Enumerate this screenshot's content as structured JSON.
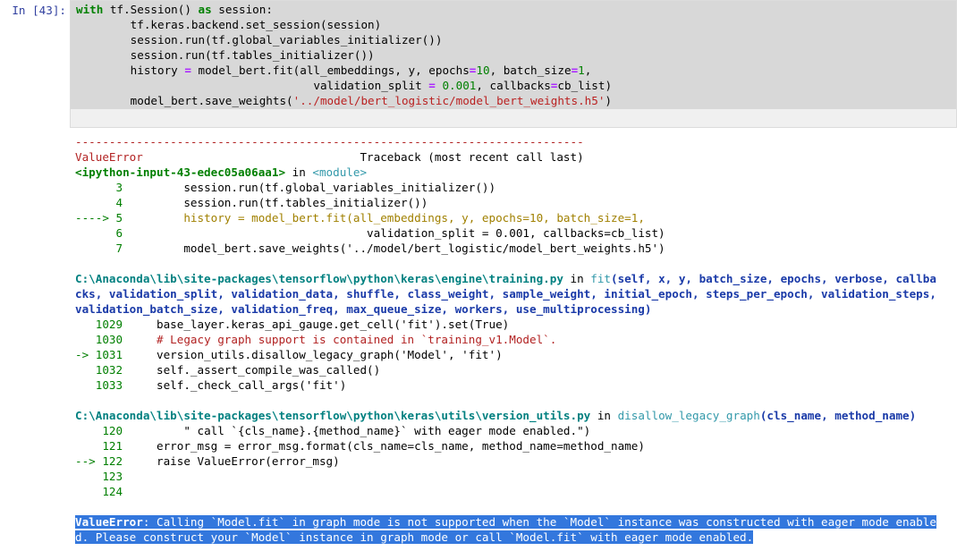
{
  "prompt": "In [43]:",
  "code": {
    "l1_kw": "with",
    "l1_rest": " tf.Session() ",
    "l1_as": "as",
    "l1_end": " session:",
    "l2": "        tf.keras.backend.set_session(session)",
    "l3": "        session.run(tf.global_variables_initializer())",
    "l4": "        session.run(tf.tables_initializer())",
    "l5_a": "        history ",
    "l5_eq": "=",
    "l5_b": " model_bert.fit(all_embeddings, y, epochs",
    "l5_eq2": "=",
    "l5_n1": "10",
    "l5_c": ", batch_size",
    "l5_eq3": "=",
    "l5_n2": "1",
    "l5_d": ",",
    "l6_a": "                                   validation_split ",
    "l6_eq": "=",
    "l6_sp": " ",
    "l6_n": "0.001",
    "l6_b": ", callbacks",
    "l6_eq2": "=",
    "l6_c": "cb_list)",
    "l7_a": "        model_bert.save_weights(",
    "l7_str": "'../model/bert_logistic/model_bert_weights.h5'",
    "l7_b": ")"
  },
  "traceback": {
    "dashes": "---------------------------------------------------------------------------",
    "err_name": "ValueError",
    "tb_header": "                                Traceback (most recent call last)",
    "input_ref": "<ipython-input-43-edec05a06aa1>",
    "in_word": " in ",
    "module": "<module>",
    "f1": [
      {
        "num": "      3",
        "code": "         session.run(tf.global_variables_initializer())"
      },
      {
        "num": "      4",
        "code": "         session.run(tf.tables_initializer())"
      }
    ],
    "f1_arrow": "----> 5",
    "f1_hl": "         history = model_bert.fit(all_embeddings, y, epochs=10, batch_size=1,",
    "f1_after": [
      {
        "num": "      6",
        "code": "                                    validation_split = 0.001, callbacks=cb_list)"
      },
      {
        "num": "      7",
        "code": "         model_bert.save_weights('../model/bert_logistic/model_bert_weights.h5')"
      }
    ],
    "f2_path": "C:\\Anaconda\\lib\\site-packages\\tensorflow\\python\\keras\\engine\\training.py",
    "f2_fn": "fit",
    "f2_sig1": "(self, x, y, batch_size, epochs, verbose, callba",
    "f2_sig2": "cks, validation_split, validation_data, shuffle, class_weight, sample_weight, initial_epoch, steps_per_epoch, validation_steps,",
    "f2_sig3": "validation_batch_size, validation_freq, max_queue_size, workers, use_multiprocessing)",
    "f2_lines": [
      {
        "num": "   1029",
        "code": "     base_layer.keras_api_gauge.get_cell('fit').set(True)"
      },
      {
        "num": "   1030",
        "code": "     # Legacy graph support is contained in `training_v1.Model`."
      }
    ],
    "f2_arrow": "-> 1031",
    "f2_hl": "     version_utils.disallow_legacy_graph('Model', 'fit')",
    "f2_after": [
      {
        "num": "   1032",
        "code": "     self._assert_compile_was_called()"
      },
      {
        "num": "   1033",
        "code": "     self._check_call_args('fit')"
      }
    ],
    "f3_path": "C:\\Anaconda\\lib\\site-packages\\tensorflow\\python\\keras\\utils\\version_utils.py",
    "f3_fn": "disallow_legacy_graph",
    "f3_sig": "(cls_name, method_name)",
    "f3_lines": [
      {
        "num": "    120",
        "code": "         \" call `{cls_name}.{method_name}` with eager mode enabled.\")"
      },
      {
        "num": "    121",
        "code": "     error_msg = error_msg.format(cls_name=cls_name, method_name=method_name)"
      }
    ],
    "f3_arrow": "--> 122",
    "f3_hl": "     raise ValueError(error_msg)",
    "f3_after": [
      {
        "num": "    123",
        "code": ""
      },
      {
        "num": "    124",
        "code": ""
      }
    ],
    "final_name": "ValueError",
    "final_msg1": ": Calling `Model.fit` in graph mode is not supported when the `Model` instance was constructed with eager mode enable",
    "final_msg2": "d. Please construct your `Model` instance in graph mode or call `Model.fit` with eager mode enabled."
  }
}
